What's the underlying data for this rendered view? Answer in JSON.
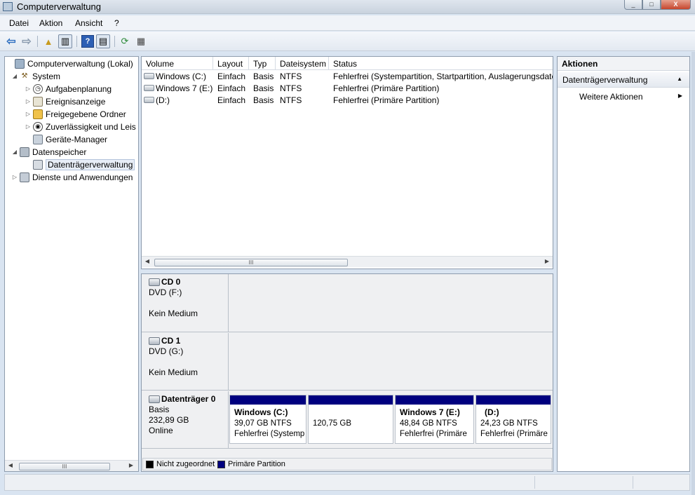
{
  "window": {
    "title": "Computerverwaltung",
    "buttons": {
      "minimize": "_",
      "maximize": "□",
      "close": "X"
    }
  },
  "menu": [
    "Datei",
    "Aktion",
    "Ansicht",
    "?"
  ],
  "toolbar": {
    "help": "?"
  },
  "tree": [
    {
      "label": "Computerverwaltung (Lokal)",
      "expander": "",
      "icon": "computer-icon"
    },
    {
      "label": "System",
      "expander": "◢",
      "icon": "tools-icon"
    },
    {
      "label": "Aufgabenplanung",
      "expander": "▷",
      "icon": "clock-icon"
    },
    {
      "label": "Ereignisanzeige",
      "expander": "▷",
      "icon": "event-viewer-icon"
    },
    {
      "label": "Freigegebene Ordner",
      "expander": "▷",
      "icon": "shared-folder-icon"
    },
    {
      "label": "Zuverlässigkeit und Leis",
      "expander": "▷",
      "icon": "performance-icon"
    },
    {
      "label": "Geräte-Manager",
      "expander": "",
      "icon": "device-manager-icon"
    },
    {
      "label": "Datenspeicher",
      "expander": "◢",
      "icon": "storage-icon"
    },
    {
      "label": "Datenträgerverwaltung",
      "expander": "",
      "icon": "disk-management-icon"
    },
    {
      "label": "Dienste und Anwendungen",
      "expander": "▷",
      "icon": "services-icon"
    }
  ],
  "volume_list": {
    "columns": [
      "Volume",
      "Layout",
      "Typ",
      "Dateisystem",
      "Status"
    ],
    "rows": [
      [
        "Windows (C:)",
        "Einfach",
        "Basis",
        "NTFS",
        "Fehlerfrei (Systempartition, Startpartition, Auslagerungsdate"
      ],
      [
        "Windows 7 (E:)",
        "Einfach",
        "Basis",
        "NTFS",
        "Fehlerfrei (Primäre Partition)"
      ],
      [
        "(D:)",
        "Einfach",
        "Basis",
        "NTFS",
        "Fehlerfrei (Primäre Partition)"
      ]
    ],
    "scroll_grip": "III"
  },
  "disks": [
    {
      "name": "CD 0",
      "type": "DVD (F:)",
      "size": "",
      "status": "Kein Medium",
      "partitions": []
    },
    {
      "name": "CD 1",
      "type": "DVD (G:)",
      "size": "",
      "status": "Kein Medium",
      "partitions": []
    },
    {
      "name": "Datenträger 0",
      "type": "Basis",
      "size": "232,89 GB",
      "status": "Online",
      "partitions": [
        {
          "name": "Windows  (C:)",
          "size": "39,07 GB NTFS",
          "status": "Fehlerfrei (Systemp"
        },
        {
          "name": "",
          "size": "120,75 GB",
          "status": ""
        },
        {
          "name": "Windows 7  (E:)",
          "size": "48,84 GB NTFS",
          "status": "Fehlerfrei (Primäre"
        },
        {
          "name": "(D:)",
          "size": "24,23 GB NTFS",
          "status": "Fehlerfrei (Primäre"
        }
      ]
    }
  ],
  "legend": [
    {
      "label": "Nicht zugeordnet",
      "color": "#000000"
    },
    {
      "label": "Primäre Partition",
      "color": "#00007f"
    }
  ],
  "left_scroll_grip": "III",
  "actions": {
    "header": "Aktionen",
    "section": "Datenträgerverwaltung",
    "items": [
      "Weitere Aktionen"
    ]
  }
}
